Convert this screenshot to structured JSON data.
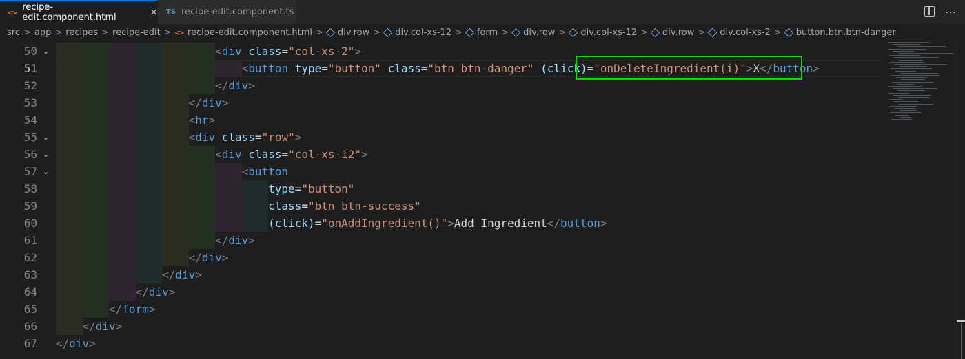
{
  "tabs": [
    {
      "label": "recipe-edit.component.html",
      "icon": "html-icon",
      "active": true,
      "close": "×",
      "glyph": "<>"
    },
    {
      "label": "recipe-edit.component.ts",
      "icon": "ts-icon",
      "active": false,
      "glyph": "TS"
    }
  ],
  "breadcrumb": [
    {
      "label": "src",
      "icon": ""
    },
    {
      "label": "app",
      "icon": ""
    },
    {
      "label": "recipes",
      "icon": ""
    },
    {
      "label": "recipe-edit",
      "icon": ""
    },
    {
      "label": "recipe-edit.component.html",
      "icon": "html-icon"
    },
    {
      "label": "div.row",
      "icon": "cube-icon"
    },
    {
      "label": "div.col-xs-12",
      "icon": "cube-icon"
    },
    {
      "label": "form",
      "icon": "cube-icon"
    },
    {
      "label": "div.row",
      "icon": "cube-icon"
    },
    {
      "label": "div.col-xs-12",
      "icon": "cube-icon"
    },
    {
      "label": "div.row",
      "icon": "cube-icon"
    },
    {
      "label": "div.col-xs-2",
      "icon": "cube-icon"
    },
    {
      "label": "button.btn.btn-danger",
      "icon": "cube-icon"
    }
  ],
  "breadcrumb_separator": ">",
  "editor": {
    "current_line": 51,
    "lines": [
      {
        "num": "50",
        "fold": true,
        "indent": 6,
        "tokens": [
          [
            "p",
            "<"
          ],
          [
            "g",
            "div"
          ],
          [
            "t",
            " "
          ],
          [
            "a",
            "class"
          ],
          [
            "t",
            "="
          ],
          [
            "s",
            "\"col-xs-2\""
          ],
          [
            "p",
            ">"
          ]
        ]
      },
      {
        "num": "51",
        "fold": false,
        "indent": 7,
        "tokens": [
          [
            "p",
            "<"
          ],
          [
            "g",
            "button"
          ],
          [
            "t",
            " "
          ],
          [
            "a",
            "type"
          ],
          [
            "t",
            "="
          ],
          [
            "s",
            "\"button\""
          ],
          [
            "t",
            " "
          ],
          [
            "a",
            "class"
          ],
          [
            "t",
            "="
          ],
          [
            "s",
            "\"btn btn-danger\""
          ],
          [
            "t",
            " "
          ],
          [
            "a",
            "(click)"
          ],
          [
            "t",
            "="
          ],
          [
            "s",
            "\"onDeleteIngredient(i)\""
          ],
          [
            "p",
            ">"
          ],
          [
            "t",
            "X"
          ],
          [
            "p",
            "</"
          ],
          [
            "g",
            "button"
          ],
          [
            "p",
            ">"
          ]
        ]
      },
      {
        "num": "52",
        "fold": false,
        "indent": 6,
        "tokens": [
          [
            "p",
            "</"
          ],
          [
            "g",
            "div"
          ],
          [
            "p",
            ">"
          ]
        ]
      },
      {
        "num": "53",
        "fold": false,
        "indent": 5,
        "tokens": [
          [
            "p",
            "</"
          ],
          [
            "g",
            "div"
          ],
          [
            "p",
            ">"
          ]
        ]
      },
      {
        "num": "54",
        "fold": false,
        "indent": 5,
        "tokens": [
          [
            "p",
            "<"
          ],
          [
            "g",
            "hr"
          ],
          [
            "p",
            ">"
          ]
        ]
      },
      {
        "num": "55",
        "fold": true,
        "indent": 5,
        "tokens": [
          [
            "p",
            "<"
          ],
          [
            "g",
            "div"
          ],
          [
            "t",
            " "
          ],
          [
            "a",
            "class"
          ],
          [
            "t",
            "="
          ],
          [
            "s",
            "\"row\""
          ],
          [
            "p",
            ">"
          ]
        ]
      },
      {
        "num": "56",
        "fold": true,
        "indent": 6,
        "tokens": [
          [
            "p",
            "<"
          ],
          [
            "g",
            "div"
          ],
          [
            "t",
            " "
          ],
          [
            "a",
            "class"
          ],
          [
            "t",
            "="
          ],
          [
            "s",
            "\"col-xs-12\""
          ],
          [
            "p",
            ">"
          ]
        ]
      },
      {
        "num": "57",
        "fold": true,
        "indent": 7,
        "tokens": [
          [
            "p",
            "<"
          ],
          [
            "g",
            "button"
          ]
        ]
      },
      {
        "num": "58",
        "fold": false,
        "indent": 8,
        "tokens": [
          [
            "a",
            "type"
          ],
          [
            "t",
            "="
          ],
          [
            "s",
            "\"button\""
          ]
        ]
      },
      {
        "num": "59",
        "fold": false,
        "indent": 8,
        "tokens": [
          [
            "a",
            "class"
          ],
          [
            "t",
            "="
          ],
          [
            "s",
            "\"btn btn-success\""
          ]
        ]
      },
      {
        "num": "60",
        "fold": false,
        "indent": 8,
        "tokens": [
          [
            "a",
            "(click)"
          ],
          [
            "t",
            "="
          ],
          [
            "s",
            "\"onAddIngredient()\""
          ],
          [
            "p",
            ">"
          ],
          [
            "t",
            "Add Ingredient"
          ],
          [
            "p",
            "</"
          ],
          [
            "g",
            "button"
          ],
          [
            "p",
            ">"
          ]
        ]
      },
      {
        "num": "61",
        "fold": false,
        "indent": 6,
        "tokens": [
          [
            "p",
            "</"
          ],
          [
            "g",
            "div"
          ],
          [
            "p",
            ">"
          ]
        ]
      },
      {
        "num": "62",
        "fold": false,
        "indent": 5,
        "tokens": [
          [
            "p",
            "</"
          ],
          [
            "g",
            "div"
          ],
          [
            "p",
            ">"
          ]
        ]
      },
      {
        "num": "63",
        "fold": false,
        "indent": 4,
        "tokens": [
          [
            "p",
            "</"
          ],
          [
            "g",
            "div"
          ],
          [
            "p",
            ">"
          ]
        ]
      },
      {
        "num": "64",
        "fold": false,
        "indent": 3,
        "tokens": [
          [
            "p",
            "</"
          ],
          [
            "g",
            "div"
          ],
          [
            "p",
            ">"
          ]
        ]
      },
      {
        "num": "65",
        "fold": false,
        "indent": 2,
        "tokens": [
          [
            "p",
            "</"
          ],
          [
            "g",
            "form"
          ],
          [
            "p",
            ">"
          ]
        ]
      },
      {
        "num": "66",
        "fold": false,
        "indent": 1,
        "tokens": [
          [
            "p",
            "</"
          ],
          [
            "g",
            "div"
          ],
          [
            "p",
            ">"
          ]
        ]
      },
      {
        "num": "67",
        "fold": false,
        "indent": 0,
        "tokens": [
          [
            "p",
            "</"
          ],
          [
            "g",
            "div"
          ],
          [
            "p",
            ">"
          ]
        ]
      }
    ]
  },
  "colors": {
    "background": "#1e1e1e",
    "tag": "#569cd6",
    "attribute": "#9cdcfe",
    "string": "#ce9178",
    "punctuation": "#808080",
    "highlight_box": "#00e000",
    "indent_bands": [
      "#2a2d1f",
      "#22301f",
      "#302433",
      "#1f2e2d",
      "#2a2d1f",
      "#22301f",
      "#302433",
      "#1f2e2d"
    ]
  },
  "icons": {
    "layout": "split-editor-icon",
    "more": "more-actions-icon",
    "fold": "chevron-down-icon"
  }
}
